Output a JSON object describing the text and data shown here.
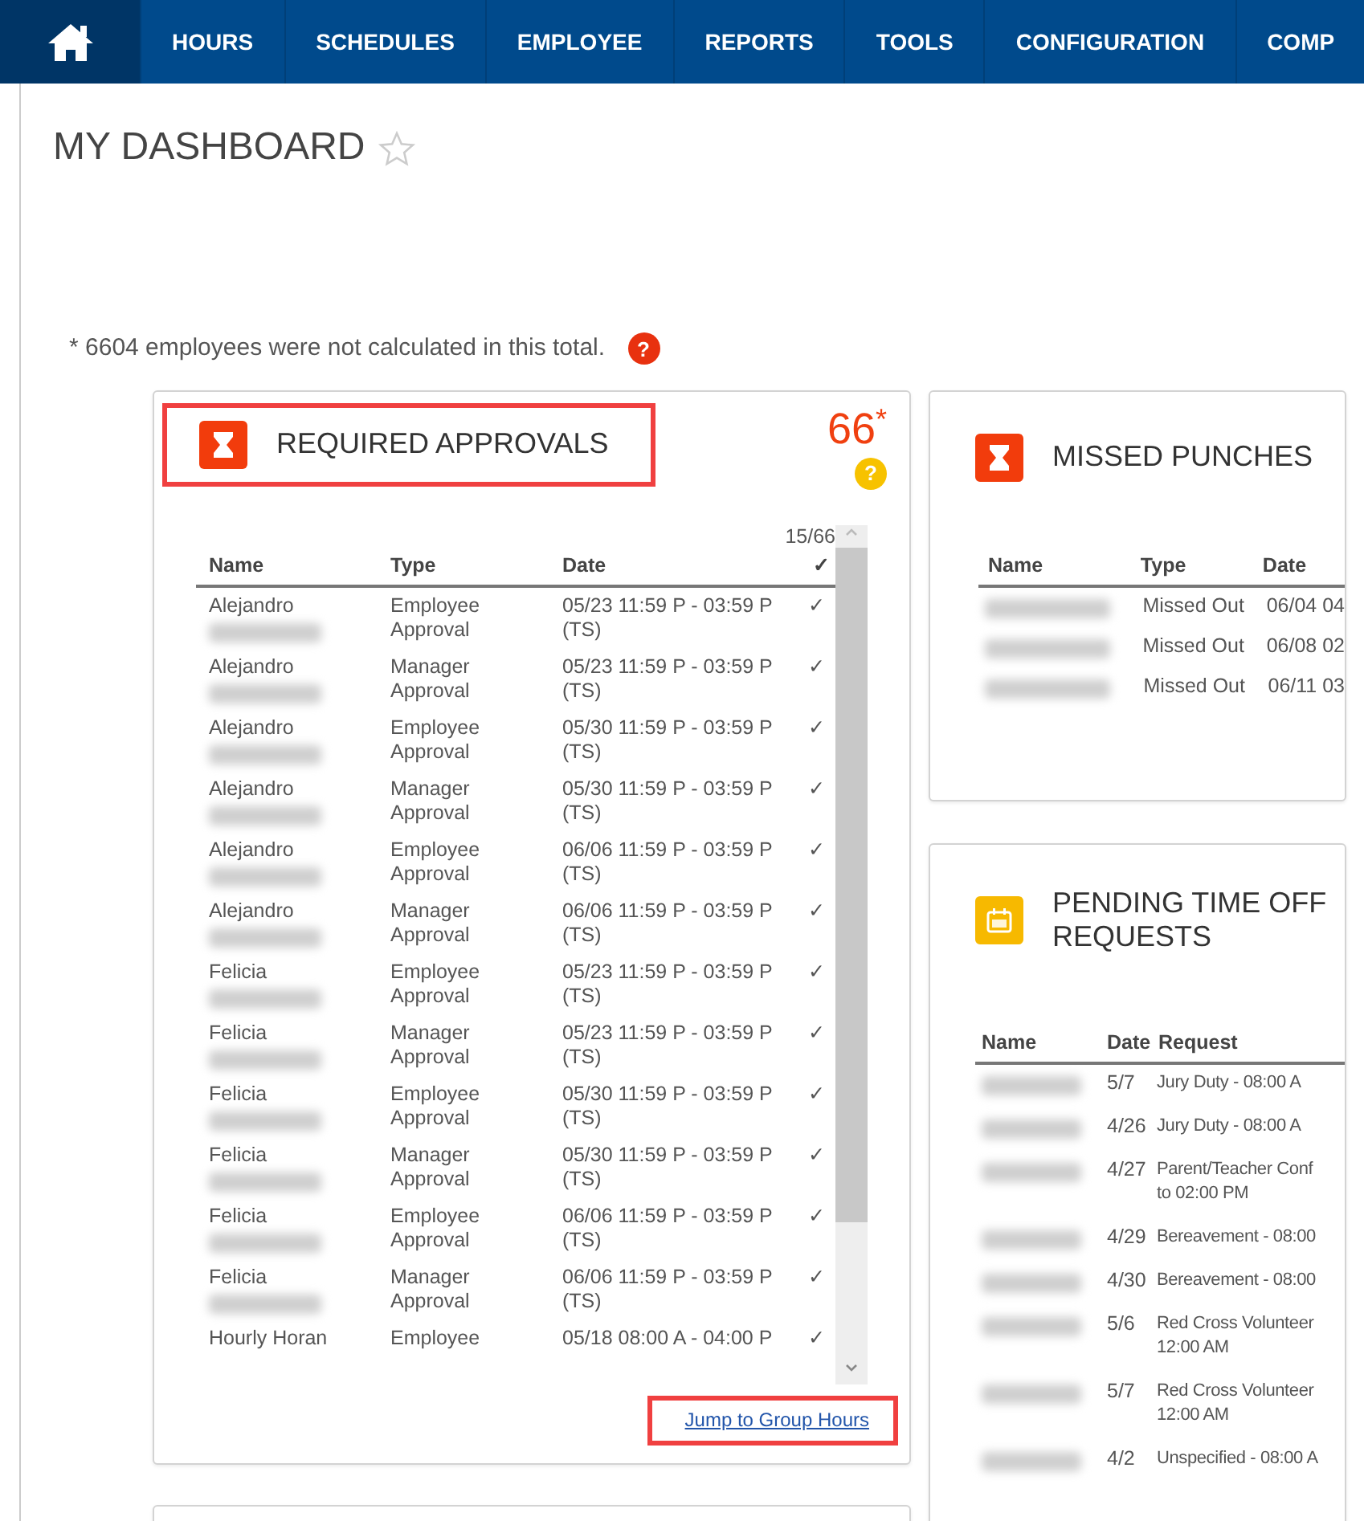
{
  "nav": {
    "items": [
      {
        "kind": "home",
        "selected": true
      },
      {
        "kind": "text",
        "label": "HOURS",
        "selected": false
      },
      {
        "kind": "text",
        "label": "SCHEDULES",
        "selected": false
      },
      {
        "kind": "text",
        "label": "EMPLOYEE",
        "selected": false
      },
      {
        "kind": "text",
        "label": "REPORTS",
        "selected": false
      },
      {
        "kind": "text",
        "label": "TOOLS",
        "selected": false
      },
      {
        "kind": "text",
        "label": "CONFIGURATION",
        "selected": false
      },
      {
        "kind": "text",
        "label": "COMP",
        "selected": false
      }
    ]
  },
  "page_title": "MY DASHBOARD",
  "favorited": false,
  "note": "* 6604 employees were not calculated in this total.",
  "note_help": "?",
  "panels": [
    {
      "kind": "approvals",
      "title": "REQUIRED APPROVALS",
      "highlighted": true,
      "count": "66",
      "count_mark": "*",
      "help": "?",
      "counter": "15/66",
      "columns": [
        "Name",
        "Type",
        "Date",
        "✓"
      ],
      "rows": [
        {
          "name": "Alejandro",
          "redacted": true,
          "type": "Employee Approval",
          "date": "05/23 11:59 P - 03:59 P (TS)",
          "check": "✓"
        },
        {
          "name": "Alejandro",
          "redacted": true,
          "type": "Manager Approval",
          "date": "05/23 11:59 P - 03:59 P (TS)",
          "check": "✓"
        },
        {
          "name": "Alejandro",
          "redacted": true,
          "type": "Employee Approval",
          "date": "05/30 11:59 P - 03:59 P (TS)",
          "check": "✓"
        },
        {
          "name": "Alejandro",
          "redacted": true,
          "type": "Manager Approval",
          "date": "05/30 11:59 P - 03:59 P (TS)",
          "check": "✓"
        },
        {
          "name": "Alejandro",
          "redacted": true,
          "type": "Employee Approval",
          "date": "06/06 11:59 P - 03:59 P (TS)",
          "check": "✓"
        },
        {
          "name": "Alejandro",
          "redacted": true,
          "type": "Manager Approval",
          "date": "06/06 11:59 P - 03:59 P (TS)",
          "check": "✓"
        },
        {
          "name": "Felicia",
          "redacted": true,
          "type": "Employee Approval",
          "date": "05/23 11:59 P - 03:59 P (TS)",
          "check": "✓"
        },
        {
          "name": "Felicia",
          "redacted": true,
          "type": "Manager Approval",
          "date": "05/23 11:59 P - 03:59 P (TS)",
          "check": "✓"
        },
        {
          "name": "Felicia",
          "redacted": true,
          "type": "Employee Approval",
          "date": "05/30 11:59 P - 03:59 P (TS)",
          "check": "✓"
        },
        {
          "name": "Felicia",
          "redacted": true,
          "type": "Manager Approval",
          "date": "05/30 11:59 P - 03:59 P (TS)",
          "check": "✓"
        },
        {
          "name": "Felicia",
          "redacted": true,
          "type": "Employee Approval",
          "date": "06/06 11:59 P - 03:59 P (TS)",
          "check": "✓"
        },
        {
          "name": "Felicia",
          "redacted": true,
          "type": "Manager Approval",
          "date": "06/06 11:59 P - 03:59 P (TS)",
          "check": "✓"
        },
        {
          "name": "Hourly Horan",
          "redacted": false,
          "type": "Employee",
          "date": "05/18 08:00 A - 04:00 P",
          "check": "✓"
        }
      ],
      "link": {
        "label": "Jump to Group Hours",
        "highlighted": true
      }
    },
    {
      "kind": "punches",
      "title": "MISSED PUNCHES",
      "highlighted": false,
      "columns": [
        "Name",
        "Type",
        "Date"
      ],
      "rows": [
        {
          "redacted": true,
          "type": "Missed Out",
          "date": "06/04 04"
        },
        {
          "redacted": true,
          "type": "Missed Out",
          "date": "06/08 02"
        },
        {
          "redacted": true,
          "type": "Missed Out",
          "date": "06/11 03"
        }
      ]
    },
    {
      "kind": "timeoff",
      "title": "PENDING TIME OFF REQUESTS",
      "highlighted": false,
      "columns": [
        "Name",
        "Date",
        "Request"
      ],
      "rows": [
        {
          "redacted": true,
          "date": "5/7",
          "request_lines": [
            "Jury Duty - 08:00 A"
          ]
        },
        {
          "redacted": true,
          "date": "4/26",
          "request_lines": [
            "Jury Duty - 08:00 A"
          ]
        },
        {
          "redacted": true,
          "date": "4/27",
          "request_lines": [
            "Parent/Teacher Conf",
            "to 02:00 PM"
          ]
        },
        {
          "redacted": true,
          "date": "4/29",
          "request_lines": [
            "Bereavement - 08:00"
          ]
        },
        {
          "redacted": true,
          "date": "4/30",
          "request_lines": [
            "Bereavement - 08:00"
          ]
        },
        {
          "redacted": true,
          "date": "5/6",
          "request_lines": [
            "Red Cross Volunteer",
            "12:00 AM"
          ]
        },
        {
          "redacted": true,
          "date": "5/7",
          "request_lines": [
            "Red Cross Volunteer",
            "12:00 AM"
          ]
        },
        {
          "redacted": true,
          "date": "4/2",
          "request_lines": [
            "Unspecified - 08:00 A"
          ]
        }
      ]
    }
  ]
}
